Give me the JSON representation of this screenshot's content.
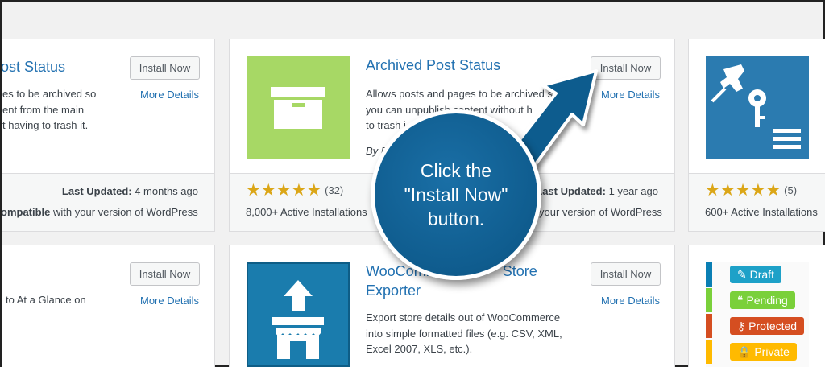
{
  "cards": {
    "top_left": {
      "title": "ost Status",
      "desc_lines": [
        "es to be archived so",
        "ent from the main",
        "t having to trash it."
      ],
      "install_label": "Install Now",
      "details_label": "More Details",
      "last_updated_label": "Last Updated:",
      "last_updated_value": "4 months ago",
      "compat_bold": "ompatible",
      "compat_rest": "with your version of WordPress"
    },
    "top_center": {
      "title": "Archived Post Status",
      "desc_lines": [
        "Allows posts and pages to be archived s",
        "you can unpublish content without h",
        "to trash i"
      ],
      "by_line": "By P",
      "install_label": "Install Now",
      "details_label": "More Details",
      "rating": 5,
      "rating_count": "(32)",
      "installs": "8,000+ Active Installations",
      "last_updated_label": "Last Updated:",
      "last_updated_value": "1 year ago",
      "compat_rest": "your version of WordPress"
    },
    "top_right": {
      "rating": 5,
      "rating_count": "(5)",
      "installs": "600+ Active Installations"
    },
    "bottom_left": {
      "desc_lines": [
        "to At a Glance on"
      ],
      "install_label": "Install Now",
      "details_label": "More Details"
    },
    "bottom_center": {
      "title_line1": "WooComm",
      "title_line1_tail": "Store",
      "title_line2": "Exporter",
      "desc_lines": [
        "Export store details out of WooCommerce",
        "into simple formatted files (e.g. CSV, XML,",
        "Excel 2007, XLS, etc.)."
      ],
      "install_label": "Install Now",
      "details_label": "More Details"
    },
    "bottom_right": {
      "statuses": [
        {
          "label": "Draft",
          "icon": "pencil-icon",
          "color": "#1ea1c8",
          "bar": "#0a7fb4"
        },
        {
          "label": "Pending",
          "icon": "comments-icon",
          "color": "#7ad03a",
          "bar": "#7ad03a"
        },
        {
          "label": "Protected",
          "icon": "key-icon",
          "color": "#d54e21",
          "bar": "#d54e21"
        },
        {
          "label": "Private",
          "icon": "lock-icon",
          "color": "#ffba00",
          "bar": "#ffba00"
        }
      ]
    }
  },
  "callout": {
    "lines": [
      "Click the",
      "\"Install Now\"",
      "button."
    ]
  },
  "colors": {
    "link": "#2271b1",
    "callout": "#0f5c8e",
    "archive_thumb": "#a7d865",
    "woo_thumb": "#1a7cad",
    "pin_thumb": "#2b7bb0",
    "star": "#dba617"
  }
}
